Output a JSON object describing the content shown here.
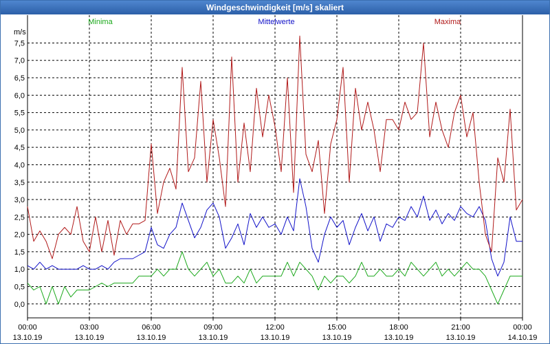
{
  "window": {
    "title": "Windgeschwindigkeit [m/s] skaliert"
  },
  "chart_data": {
    "type": "line",
    "title": "Windgeschwindigkeit [m/s] skaliert",
    "ylabel": "m/s",
    "ylim": [
      -0.4,
      8.3
    ],
    "yticks": [
      0,
      0.5,
      1,
      1.5,
      2,
      2.5,
      3,
      3.5,
      4,
      4.5,
      5,
      5.5,
      6,
      6.5,
      7,
      7.5
    ],
    "ytick_labels": [
      "0,0",
      "0,5",
      "1,0",
      "1,5",
      "2,0",
      "2,5",
      "3,0",
      "3,5",
      "4,0",
      "4,5",
      "5,0",
      "5,5",
      "6,0",
      "6,5",
      "7,0",
      "7,5"
    ],
    "xlim": [
      0,
      24
    ],
    "xticks": [
      {
        "x": 0,
        "time": "00:00",
        "date": "13.10.19"
      },
      {
        "x": 3,
        "time": "03:00",
        "date": "13.10.19"
      },
      {
        "x": 6,
        "time": "06:00",
        "date": "13.10.19"
      },
      {
        "x": 9,
        "time": "09:00",
        "date": "13.10.19"
      },
      {
        "x": 12,
        "time": "12:00",
        "date": "13.10.19"
      },
      {
        "x": 15,
        "time": "15:00",
        "date": "13.10.19"
      },
      {
        "x": 18,
        "time": "18:00",
        "date": "13.10.19"
      },
      {
        "x": 21,
        "time": "21:00",
        "date": "13.10.19"
      },
      {
        "x": 24,
        "time": "00:00",
        "date": "14.10.19"
      }
    ],
    "grid": true,
    "series": [
      {
        "name": "Minima",
        "color": "#1aa81a",
        "x": [
          0,
          0.3,
          0.6,
          0.9,
          1.2,
          1.5,
          1.8,
          2.1,
          2.4,
          2.7,
          3.0,
          3.3,
          3.6,
          3.9,
          4.2,
          4.5,
          4.8,
          5.1,
          5.4,
          5.7,
          6.0,
          6.3,
          6.6,
          6.9,
          7.2,
          7.5,
          7.8,
          8.1,
          8.4,
          8.7,
          9.0,
          9.3,
          9.6,
          9.9,
          10.2,
          10.5,
          10.8,
          11.1,
          11.4,
          11.7,
          12.0,
          12.3,
          12.6,
          12.9,
          13.2,
          13.5,
          13.8,
          14.1,
          14.4,
          14.7,
          15.0,
          15.3,
          15.6,
          15.9,
          16.2,
          16.5,
          16.8,
          17.1,
          17.4,
          17.7,
          18.0,
          18.3,
          18.6,
          18.9,
          19.2,
          19.5,
          19.8,
          20.1,
          20.4,
          20.7,
          21.0,
          21.3,
          21.6,
          21.9,
          22.2,
          22.5,
          22.8,
          23.1,
          23.4,
          23.7,
          24.0
        ],
        "y": [
          0.6,
          0.4,
          0.5,
          0.0,
          0.5,
          0.0,
          0.5,
          0.2,
          0.4,
          0.4,
          0.4,
          0.5,
          0.6,
          0.5,
          0.6,
          0.6,
          0.6,
          0.6,
          0.8,
          0.8,
          0.8,
          1.0,
          0.8,
          1.0,
          1.0,
          1.5,
          1.0,
          0.8,
          1.0,
          1.2,
          0.8,
          1.0,
          0.6,
          0.6,
          0.8,
          0.6,
          1.0,
          0.6,
          0.8,
          0.8,
          0.8,
          0.8,
          1.2,
          0.8,
          1.2,
          1.0,
          0.8,
          0.4,
          0.8,
          0.6,
          0.8,
          0.8,
          0.6,
          0.8,
          1.2,
          0.8,
          0.8,
          1.0,
          0.8,
          0.8,
          1.0,
          0.8,
          1.2,
          1.0,
          0.8,
          1.0,
          1.2,
          0.8,
          1.0,
          0.8,
          1.0,
          1.2,
          1.0,
          1.0,
          0.8,
          0.4,
          0.0,
          0.4,
          0.8,
          0.8,
          0.8
        ]
      },
      {
        "name": "Mittelwerte",
        "color": "#1010c8",
        "x": [
          0,
          0.3,
          0.6,
          0.9,
          1.2,
          1.5,
          1.8,
          2.1,
          2.4,
          2.7,
          3.0,
          3.3,
          3.6,
          3.9,
          4.2,
          4.5,
          4.8,
          5.1,
          5.4,
          5.7,
          6.0,
          6.3,
          6.6,
          6.9,
          7.2,
          7.5,
          7.8,
          8.1,
          8.4,
          8.7,
          9.0,
          9.3,
          9.6,
          9.9,
          10.2,
          10.5,
          10.8,
          11.1,
          11.4,
          11.7,
          12.0,
          12.3,
          12.6,
          12.9,
          13.2,
          13.5,
          13.8,
          14.1,
          14.4,
          14.7,
          15.0,
          15.3,
          15.6,
          15.9,
          16.2,
          16.5,
          16.8,
          17.1,
          17.4,
          17.7,
          18.0,
          18.3,
          18.6,
          18.9,
          19.2,
          19.5,
          19.8,
          20.1,
          20.4,
          20.7,
          21.0,
          21.3,
          21.6,
          21.9,
          22.2,
          22.5,
          22.8,
          23.1,
          23.4,
          23.7,
          24.0
        ],
        "y": [
          1.1,
          1.0,
          1.2,
          1.0,
          1.1,
          1.0,
          1.0,
          1.0,
          1.0,
          1.1,
          1.0,
          1.0,
          1.1,
          1.0,
          1.2,
          1.3,
          1.3,
          1.3,
          1.4,
          1.5,
          2.2,
          1.7,
          1.6,
          2.0,
          2.2,
          2.9,
          2.4,
          1.9,
          2.2,
          2.7,
          2.9,
          2.5,
          1.6,
          1.9,
          2.3,
          1.7,
          2.6,
          2.2,
          2.5,
          2.2,
          2.3,
          2.0,
          2.5,
          2.1,
          3.6,
          2.8,
          1.6,
          1.2,
          2.0,
          2.5,
          2.2,
          2.4,
          1.7,
          2.2,
          2.6,
          2.1,
          2.5,
          1.8,
          2.3,
          2.2,
          2.5,
          2.4,
          2.8,
          2.5,
          3.1,
          2.4,
          2.7,
          2.3,
          2.6,
          2.4,
          2.8,
          2.6,
          2.5,
          2.8,
          2.4,
          1.3,
          0.8,
          1.2,
          2.5,
          1.8,
          1.8
        ]
      },
      {
        "name": "Maxima",
        "color": "#b01818",
        "x": [
          0,
          0.3,
          0.6,
          0.9,
          1.2,
          1.5,
          1.8,
          2.1,
          2.4,
          2.7,
          3.0,
          3.3,
          3.6,
          3.9,
          4.2,
          4.5,
          4.8,
          5.1,
          5.4,
          5.7,
          6.0,
          6.3,
          6.6,
          6.9,
          7.2,
          7.5,
          7.8,
          8.1,
          8.4,
          8.7,
          9.0,
          9.3,
          9.6,
          9.9,
          10.2,
          10.5,
          10.8,
          11.1,
          11.4,
          11.7,
          12.0,
          12.3,
          12.6,
          12.9,
          13.2,
          13.5,
          13.8,
          14.1,
          14.4,
          14.7,
          15.0,
          15.3,
          15.6,
          15.9,
          16.2,
          16.5,
          16.8,
          17.1,
          17.4,
          17.7,
          18.0,
          18.3,
          18.6,
          18.9,
          19.2,
          19.5,
          19.8,
          20.1,
          20.4,
          20.7,
          21.0,
          21.3,
          21.6,
          21.9,
          22.2,
          22.5,
          22.8,
          23.1,
          23.4,
          23.7,
          24.0
        ],
        "y": [
          2.8,
          1.8,
          2.1,
          1.8,
          1.3,
          2.0,
          2.2,
          2.0,
          2.8,
          1.8,
          1.5,
          2.5,
          1.5,
          2.4,
          1.4,
          2.4,
          2.0,
          2.3,
          2.3,
          2.4,
          4.6,
          2.6,
          3.5,
          3.9,
          3.3,
          6.8,
          3.8,
          4.2,
          6.4,
          3.5,
          5.3,
          4.2,
          2.8,
          7.1,
          3.5,
          5.2,
          3.8,
          6.2,
          4.8,
          6.0,
          5.1,
          3.8,
          6.5,
          3.2,
          7.7,
          4.3,
          3.8,
          4.7,
          2.6,
          4.6,
          5.3,
          6.8,
          3.5,
          6.2,
          5.0,
          5.8,
          5.0,
          3.8,
          5.3,
          5.3,
          5.0,
          5.8,
          5.3,
          5.5,
          7.5,
          4.8,
          5.8,
          5.0,
          4.5,
          5.5,
          6.0,
          4.8,
          5.5,
          3.5,
          2.0,
          1.5,
          4.2,
          3.5,
          5.6,
          2.7,
          3.0
        ]
      }
    ]
  }
}
